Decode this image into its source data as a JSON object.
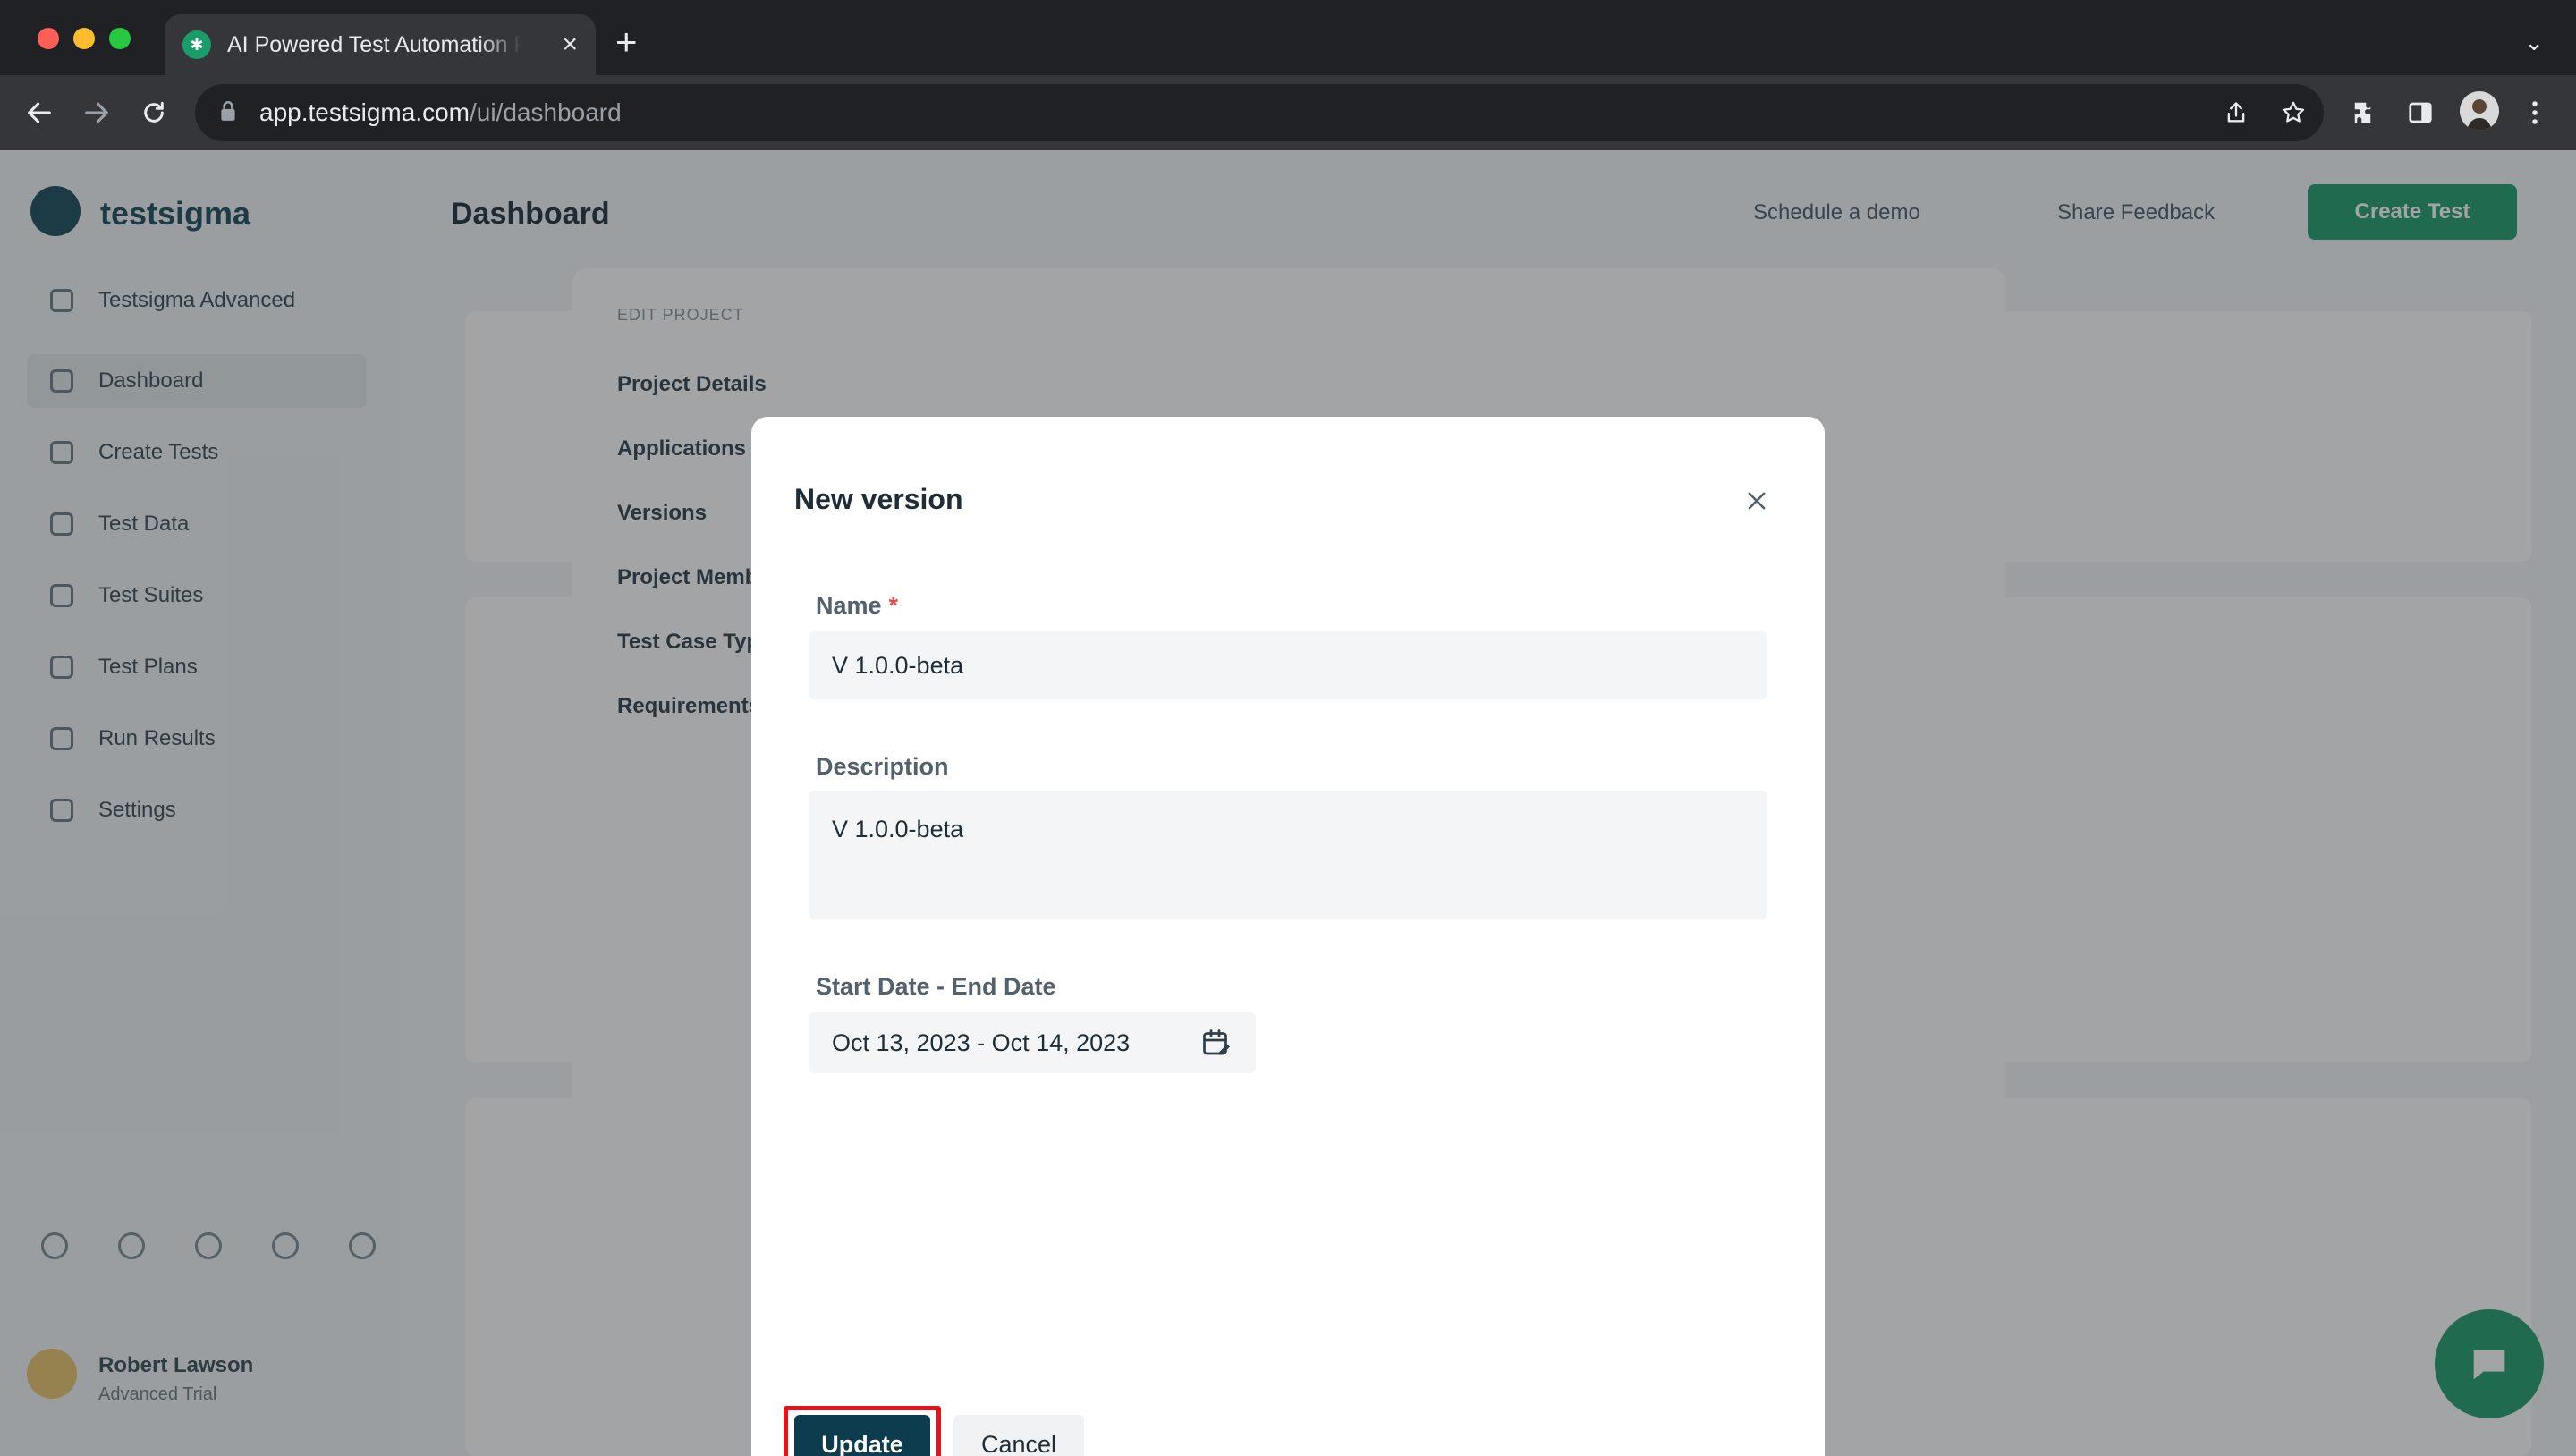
{
  "browser": {
    "tab_title": "AI Powered Test Automation Platform",
    "url_host": "app.testsigma.com",
    "url_path": "/ui/dashboard"
  },
  "app": {
    "logo_text": "testsigma",
    "page_title": "Dashboard",
    "header_links": [
      "Schedule a demo",
      "Share Feedback"
    ],
    "primary_action": "Create Test",
    "sidebar": {
      "items": [
        {
          "label": "Testsigma Advanced",
          "icon": "home-icon"
        },
        {
          "label": "Dashboard",
          "icon": "dashboard-icon"
        },
        {
          "label": "Create Tests",
          "icon": "create-icon"
        },
        {
          "label": "Test Data",
          "icon": "data-icon"
        },
        {
          "label": "Test Suites",
          "icon": "suites-icon"
        },
        {
          "label": "Test Plans",
          "icon": "plans-icon"
        },
        {
          "label": "Run Results",
          "icon": "results-icon"
        },
        {
          "label": "Settings",
          "icon": "settings-icon"
        }
      ],
      "user_name": "Robert Lawson",
      "user_sub": "Advanced Trial"
    },
    "background_modal": {
      "heading": "EDIT PROJECT",
      "menu": [
        "Project Details",
        "Applications",
        "Versions",
        "Project Members",
        "Test Case Types",
        "Requirements"
      ]
    }
  },
  "modal": {
    "title": "New version",
    "name_label": "Name",
    "required_mark": "*",
    "name_value": "V 1.0.0-beta",
    "description_label": "Description",
    "description_value": "V 1.0.0-beta",
    "date_label": "Start Date - End Date",
    "date_value": "Oct 13, 2023 - Oct 14, 2023",
    "update_label": "Update",
    "cancel_label": "Cancel"
  },
  "colors": {
    "primary_button": "#0e3c4f",
    "highlight_border": "#e5141a",
    "brand_green": "#1f9d6b"
  }
}
